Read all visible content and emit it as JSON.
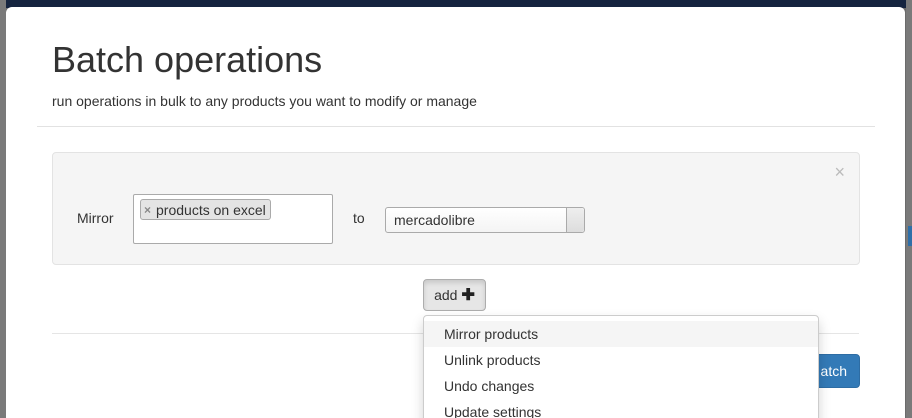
{
  "modal": {
    "title": "Batch operations",
    "subtitle": "run operations in bulk to any products you want to modify or manage"
  },
  "operation": {
    "action_label": "Mirror",
    "source_tags": [
      "products on excel"
    ],
    "to_label": "to",
    "target_value": "mercadolibre",
    "close_symbol": "×"
  },
  "add_button": {
    "label": "add",
    "icon": "plus-icon",
    "icon_glyph": "✚"
  },
  "add_menu": {
    "items": [
      "Mirror products",
      "Unlink products",
      "Undo changes",
      "Update settings"
    ],
    "highlighted": "Mirror products"
  },
  "footer": {
    "primary_button_label_visible": "atch"
  },
  "colors": {
    "primary": "#337ab7",
    "panel_background": "#f5f5f5",
    "overlay": "#6b6b6b",
    "top_bar": "#15243f"
  }
}
